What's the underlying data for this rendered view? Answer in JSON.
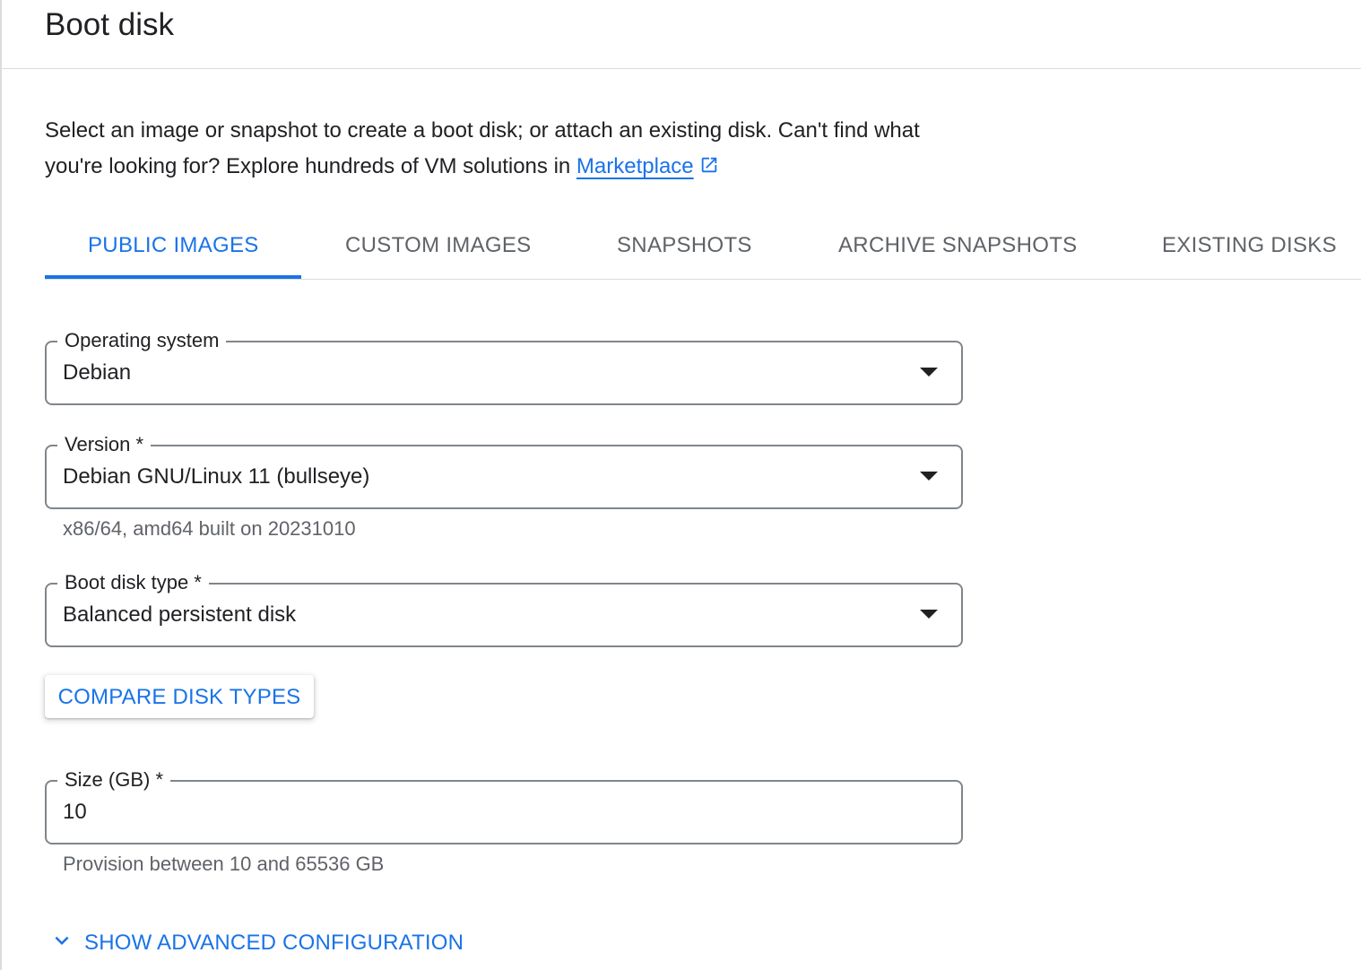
{
  "header": {
    "title": "Boot disk"
  },
  "description": {
    "text": "Select an image or snapshot to create a boot disk; or attach an existing disk. Can't find what you're looking for? Explore hundreds of VM solutions in ",
    "link_label": "Marketplace",
    "link_icon": "open-in-new-icon"
  },
  "tabs": [
    {
      "label": "PUBLIC IMAGES",
      "active": true
    },
    {
      "label": "CUSTOM IMAGES",
      "active": false
    },
    {
      "label": "SNAPSHOTS",
      "active": false
    },
    {
      "label": "ARCHIVE SNAPSHOTS",
      "active": false
    },
    {
      "label": "EXISTING DISKS",
      "active": false
    }
  ],
  "fields": {
    "operating_system": {
      "label": "Operating system",
      "value": "Debian"
    },
    "version": {
      "label": "Version *",
      "value": "Debian GNU/Linux 11 (bullseye)",
      "hint": "x86/64, amd64 built on 20231010"
    },
    "boot_disk_type": {
      "label": "Boot disk type *",
      "value": "Balanced persistent disk"
    },
    "size": {
      "label": "Size (GB) *",
      "value": "10",
      "hint": "Provision between 10 and 65536 GB"
    }
  },
  "buttons": {
    "compare_disk_types": "COMPARE DISK TYPES",
    "show_advanced": "SHOW ADVANCED CONFIGURATION"
  },
  "colors": {
    "accent": "#1a73e8",
    "text": "#202124",
    "secondary_text": "#5f6368",
    "border": "#80868b",
    "divider": "#dadce0"
  }
}
